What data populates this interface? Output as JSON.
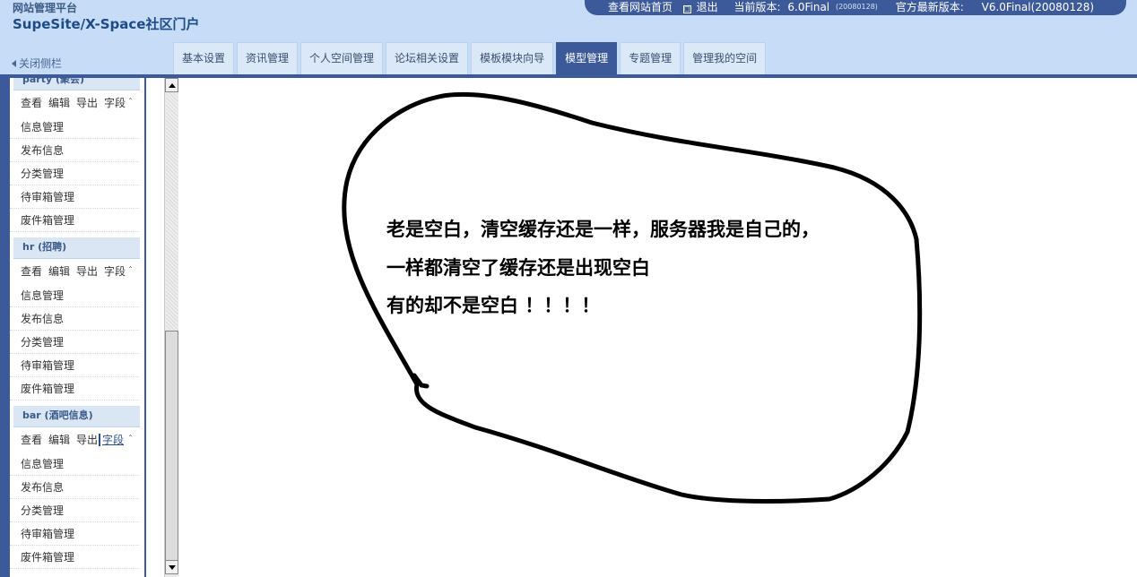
{
  "header": {
    "brand_small": "网站管理平台",
    "brand_big": "SupeSite/X-Space社区门户",
    "collapse_label": "关闭侧栏"
  },
  "topbar": {
    "view_site": "查看网站首页",
    "logout": "退出",
    "current_version_label": "当前版本:",
    "current_version": "6.0Final",
    "current_build": "(20080128)",
    "latest_version_label": "官方最新版本:",
    "latest_version": "V6.0Final(20080128)"
  },
  "tabs": [
    {
      "label": "基本设置"
    },
    {
      "label": "资讯管理"
    },
    {
      "label": "个人空间管理"
    },
    {
      "label": "论坛相关设置"
    },
    {
      "label": "模板模块向导"
    },
    {
      "label": "模型管理",
      "active": true
    },
    {
      "label": "专题管理"
    },
    {
      "label": "管理我的空间"
    }
  ],
  "sidebar": {
    "groups": [
      {
        "title": "party (聚会)",
        "actions": [
          "查看",
          "编辑",
          "导出",
          "字段"
        ],
        "items": [
          "信息管理",
          "发布信息",
          "分类管理",
          "待审箱管理",
          "废件箱管理"
        ]
      },
      {
        "title": "hr (招聘)",
        "actions": [
          "查看",
          "编辑",
          "导出",
          "字段"
        ],
        "items": [
          "信息管理",
          "发布信息",
          "分类管理",
          "待审箱管理",
          "废件箱管理"
        ]
      },
      {
        "title": "bar (酒吧信息)",
        "actions": [
          "查看",
          "编辑",
          "导出",
          "字段"
        ],
        "items": [
          "信息管理",
          "发布信息",
          "分类管理",
          "待审箱管理",
          "废件箱管理"
        ]
      }
    ],
    "caret": "ˆ"
  },
  "main": {
    "note_lines": [
      "老是空白，清空缓存还是一样，服务器我是自己的，",
      "一样都清空了缓存还是出现空白",
      "有的却不是空白 ！！！！"
    ]
  },
  "colors": {
    "header_bg": "#c6dcf7",
    "accent": "#3c5a99",
    "tab_bg": "#dbe8f8"
  }
}
